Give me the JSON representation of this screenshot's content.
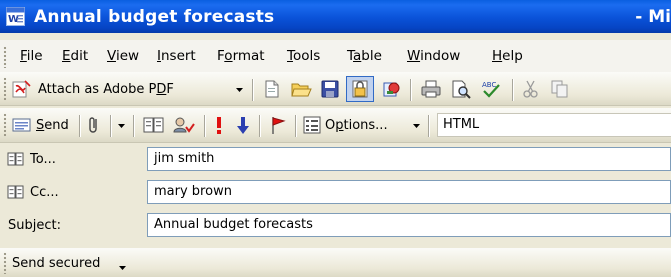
{
  "window": {
    "title": "Annual budget forecasts",
    "title_suffix": "- Mi",
    "icon": "word-document-icon"
  },
  "menubar": {
    "items": [
      {
        "label": "File",
        "accel": "F",
        "rest": "ile"
      },
      {
        "label": "Edit",
        "accel": "E",
        "rest": "dit"
      },
      {
        "label": "View",
        "accel": "V",
        "rest": "iew"
      },
      {
        "label": "Insert",
        "accel": "I",
        "rest": "nsert"
      },
      {
        "label": "Format",
        "pre": "F",
        "accel": "o",
        "rest": "rmat"
      },
      {
        "label": "Tools",
        "accel": "T",
        "rest": "ools"
      },
      {
        "label": "Table",
        "pre": "T",
        "accel": "a",
        "rest": "ble"
      },
      {
        "label": "Window",
        "accel": "W",
        "rest": "indow"
      },
      {
        "label": "Help",
        "accel": "H",
        "rest": "elp"
      }
    ]
  },
  "toolbar1": {
    "attach_pdf_label_pre": "Attach as Adobe P",
    "attach_pdf_accel": "D",
    "attach_pdf_label_post": "F",
    "icons": [
      "new-icon",
      "open-icon",
      "save-icon",
      "permission-icon",
      "research-icon",
      "print-icon",
      "print-preview-icon",
      "spelling-icon",
      "cut-icon",
      "copy-icon"
    ]
  },
  "toolbar2": {
    "send_accel": "S",
    "send_rest": "end",
    "options_pre": "O",
    "options_accel": "p",
    "options_rest": "tions...",
    "format_value": "HTML",
    "icons": [
      "attach-file-icon",
      "address-book-icon",
      "check-names-icon",
      "importance-high-icon",
      "importance-low-icon",
      "follow-up-flag-icon",
      "options-icon"
    ]
  },
  "fields": {
    "to_label": "To...",
    "to_value": "jim smith",
    "cc_label": "Cc...",
    "cc_value": "mary brown",
    "subject_label": "Subject:",
    "subject_value": "Annual budget forecasts"
  },
  "bottombar": {
    "send_secured_label": "Send secured"
  },
  "colors": {
    "titlebar": "#0a52d8",
    "chrome": "#ece9d8",
    "field_border": "#7f9db9",
    "importance_high": "#e01010",
    "importance_low": "#2b3fb0"
  }
}
